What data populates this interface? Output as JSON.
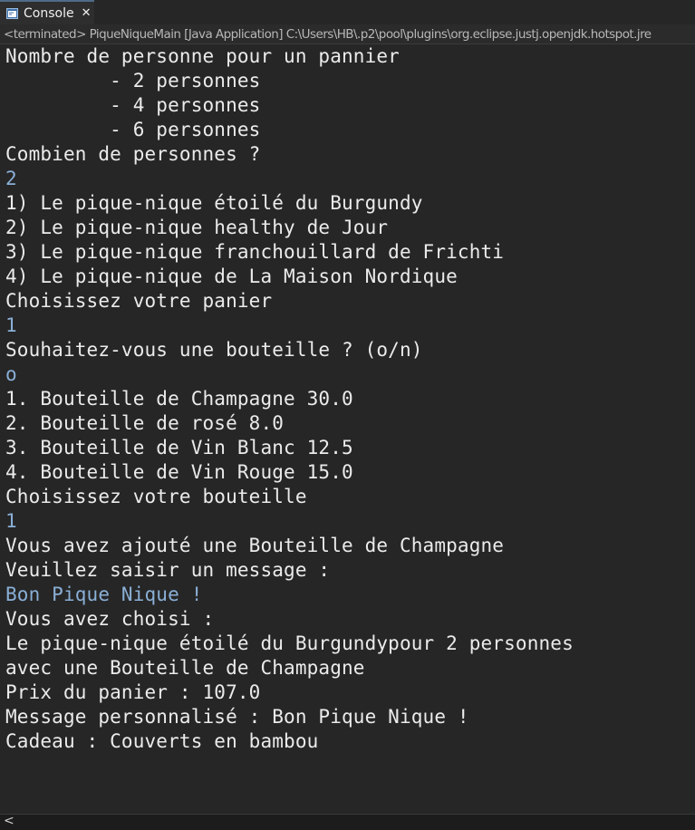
{
  "tab": {
    "icon": "console-icon",
    "label": "Console",
    "close": "✕"
  },
  "status_line": "<terminated> PiqueNiqueMain [Java Application] C:\\Users\\HB\\.p2\\pool\\plugins\\org.eclipse.justj.openjdk.hotspot.jre",
  "console_lines": [
    {
      "text": "Nombre de personne pour un pannier",
      "kind": "output"
    },
    {
      "text": "         - 2 personnes",
      "kind": "output"
    },
    {
      "text": "         - 4 personnes",
      "kind": "output"
    },
    {
      "text": "         - 6 personnes",
      "kind": "output"
    },
    {
      "text": "Combien de personnes ?",
      "kind": "output"
    },
    {
      "text": "2",
      "kind": "input"
    },
    {
      "text": "1) Le pique-nique étoilé du Burgundy",
      "kind": "output"
    },
    {
      "text": "2) Le pique-nique healthy de Jour",
      "kind": "output"
    },
    {
      "text": "3) Le pique-nique franchouillard de Frichti",
      "kind": "output"
    },
    {
      "text": "4) Le pique-nique de La Maison Nordique",
      "kind": "output"
    },
    {
      "text": "Choisissez votre panier",
      "kind": "output"
    },
    {
      "text": "1",
      "kind": "input"
    },
    {
      "text": "Souhaitez-vous une bouteille ? (o/n)",
      "kind": "output"
    },
    {
      "text": "o",
      "kind": "input"
    },
    {
      "text": "1. Bouteille de Champagne 30.0",
      "kind": "output"
    },
    {
      "text": "2. Bouteille de rosé 8.0",
      "kind": "output"
    },
    {
      "text": "3. Bouteille de Vin Blanc 12.5",
      "kind": "output"
    },
    {
      "text": "4. Bouteille de Vin Rouge 15.0",
      "kind": "output"
    },
    {
      "text": "Choisissez votre bouteille",
      "kind": "output"
    },
    {
      "text": "1",
      "kind": "input"
    },
    {
      "text": "Vous avez ajouté une Bouteille de Champagne",
      "kind": "output"
    },
    {
      "text": "Veuillez saisir un message :",
      "kind": "output"
    },
    {
      "text": "Bon Pique Nique !",
      "kind": "input"
    },
    {
      "text": "Vous avez choisi :",
      "kind": "output"
    },
    {
      "text": "Le pique-nique étoilé du Burgundypour 2 personnes",
      "kind": "output"
    },
    {
      "text": "avec une Bouteille de Champagne",
      "kind": "output"
    },
    {
      "text": "Prix du panier : 107.0",
      "kind": "output"
    },
    {
      "text": "Message personnalisé : Bon Pique Nique !",
      "kind": "output"
    },
    {
      "text": "Cadeau : Couverts en bambou",
      "kind": "output"
    }
  ],
  "scrollbar": {
    "left_icon": "scroll-left-icon",
    "left_glyph": "<"
  },
  "colors": {
    "background": "#262626",
    "output_text": "#ebebeb",
    "input_text": "#8aafd6",
    "status_text": "#b7b7b7"
  }
}
